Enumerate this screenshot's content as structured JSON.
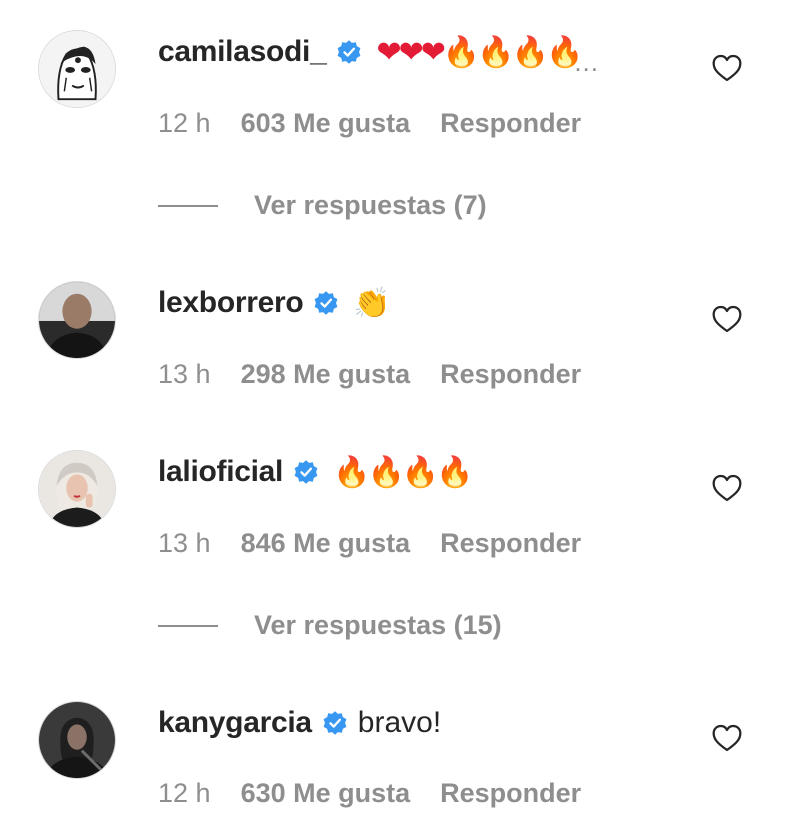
{
  "comments": [
    {
      "username": "camilasodi_",
      "text": "",
      "emoji": [
        "❤",
        "❤",
        "❤"
      ],
      "emoji_fire": [
        "🔥",
        "🔥"
      ],
      "emoji_faded": [
        "🔥",
        "🔥"
      ],
      "more": "...",
      "time": "12 h",
      "likes": "603 Me gusta",
      "reply": "Responder",
      "view_replies": "Ver respuestas (7)"
    },
    {
      "username": "lexborrero",
      "emoji": "👏",
      "time": "13 h",
      "likes": "298 Me gusta",
      "reply": "Responder"
    },
    {
      "username": "lalioficial",
      "emoji": "🔥🔥🔥🔥",
      "time": "13 h",
      "likes": "846 Me gusta",
      "reply": "Responder",
      "view_replies": "Ver respuestas (15)"
    },
    {
      "username": "kanygarcia",
      "text": "bravo!",
      "time": "12 h",
      "likes": "630 Me gusta",
      "reply": "Responder"
    }
  ],
  "colors": {
    "verified_badge": "#3897f0",
    "secondary_text": "#8e8e8e",
    "primary_text": "#262626"
  },
  "icons": {
    "verified": "verified-badge-icon",
    "like": "heart-outline-icon"
  }
}
